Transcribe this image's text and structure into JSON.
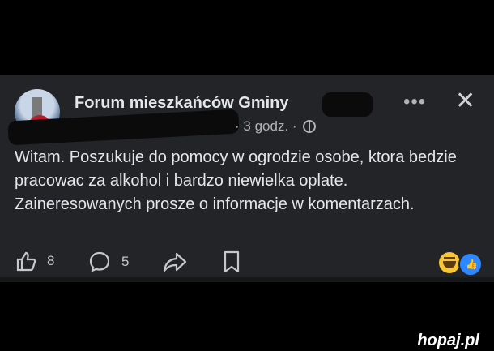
{
  "post": {
    "group_name": "Forum mieszkańców Gminy",
    "time": "3 godz.",
    "dot": "·",
    "text": "Witam. Poszukuje do pomocy w ogrodzie osobe, ktora bedzie pracowac za alkohol i bardzo niewielka oplate. Zaineresowanych prosze o informacje w komentarzach."
  },
  "header_actions": {
    "more_label": "•••",
    "close_label": "✕"
  },
  "actions": {
    "like_count": "8",
    "comment_count": "5"
  },
  "reactions": [
    "haha-emoji",
    "like-emoji"
  ],
  "watermark": {
    "text": "hopaj.pl"
  },
  "colors": {
    "card_bg": "#232427",
    "text": "#e4e6eb",
    "meta": "#b0b3b8",
    "like_blue": "#2d88ff"
  }
}
